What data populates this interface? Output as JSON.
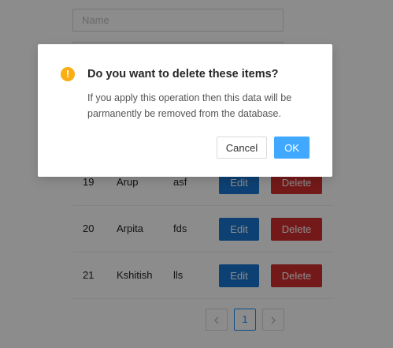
{
  "form": {
    "name_placeholder": "Name"
  },
  "table": {
    "rows": [
      {
        "id": "19",
        "name": "Arup",
        "desc": "asf",
        "edit_label": "Edit",
        "delete_label": "Delete"
      },
      {
        "id": "20",
        "name": "Arpita",
        "desc": "fds",
        "edit_label": "Edit",
        "delete_label": "Delete"
      },
      {
        "id": "21",
        "name": "Kshitish",
        "desc": "lls",
        "edit_label": "Edit",
        "delete_label": "Delete"
      }
    ]
  },
  "pagination": {
    "current_page": "1",
    "prev_icon": "chevron-left-icon",
    "next_icon": "chevron-right-icon"
  },
  "modal": {
    "icon": "exclamation-circle-icon",
    "title": "Do you want to delete these items?",
    "content_line1": "If you apply this operation then this data will be",
    "content_line2": "parmanently be removed from the database.",
    "cancel_label": "Cancel",
    "ok_label": "OK"
  },
  "colors": {
    "primary": "#1890ff",
    "warning": "#faad14",
    "edit_button": "#1976d2",
    "delete_button": "#d32f2f"
  }
}
